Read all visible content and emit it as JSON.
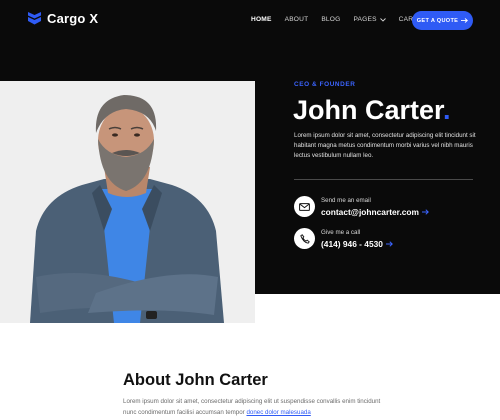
{
  "header": {
    "logo_text": "Cargo X",
    "nav": [
      {
        "label": "HOME"
      },
      {
        "label": "ABOUT"
      },
      {
        "label": "BLOG"
      },
      {
        "label": "PAGES"
      },
      {
        "label": "CART (0)"
      }
    ],
    "cta_label": "GET A QUOTE"
  },
  "hero": {
    "eyebrow": "CEO & FOUNDER",
    "name": "John Carter",
    "name_dot": ".",
    "bio": "Lorem ipsum dolor sit amet, consectetur adipiscing elit tincidunt sit habitant magna metus condimentum morbi varius vel nibh mauris lectus vestibulum nullam leo.",
    "email": {
      "label": "Send me an email",
      "value": "contact@johncarter.com"
    },
    "phone": {
      "label": "Give me a call",
      "value": "(414) 946 - 4530"
    }
  },
  "about": {
    "title": "About John Carter",
    "text": "Lorem ipsum dolor sit amet, consectetur adipiscing elit ut suspendisse convallis enim tincidunt nunc condimentum facilisi accumsan tempor ",
    "link": "donec dolor malesuada"
  },
  "colors": {
    "accent": "#2f5bf5",
    "dark": "#0a0a0a"
  },
  "icons": [
    "logo-icon",
    "chevron-down-icon",
    "arrow-right-icon",
    "mail-icon",
    "phone-icon"
  ]
}
